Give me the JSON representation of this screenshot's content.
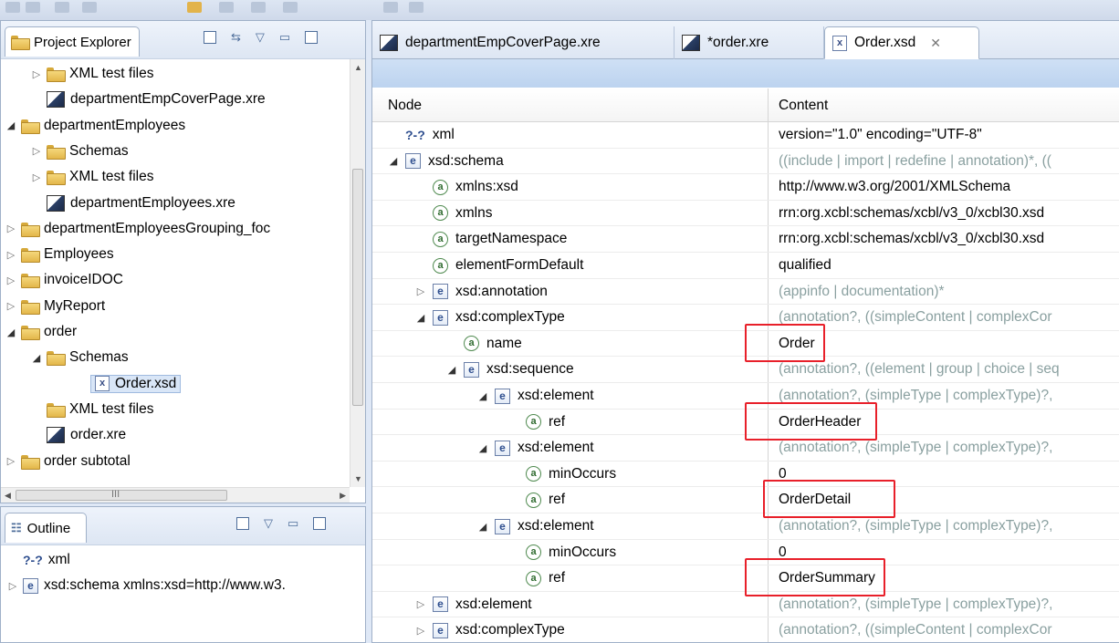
{
  "explorer": {
    "title": "Project Explorer",
    "items": [
      {
        "label": "XML test files",
        "type": "folder",
        "level": 2,
        "expand": "closed"
      },
      {
        "label": "departmentEmpCoverPage.xre",
        "type": "xre",
        "level": 2,
        "expand": "none"
      },
      {
        "label": "departmentEmployees",
        "type": "folder",
        "level": 1,
        "expand": "open"
      },
      {
        "label": "Schemas",
        "type": "folder",
        "level": 2,
        "expand": "closed"
      },
      {
        "label": "XML test files",
        "type": "folder",
        "level": 2,
        "expand": "closed"
      },
      {
        "label": "departmentEmployees.xre",
        "type": "xre",
        "level": 2,
        "expand": "none"
      },
      {
        "label": "departmentEmployeesGrouping_foc",
        "type": "folder",
        "level": 1,
        "expand": "closed"
      },
      {
        "label": "Employees",
        "type": "folder",
        "level": 1,
        "expand": "closed"
      },
      {
        "label": "invoiceIDOC",
        "type": "folder",
        "level": 1,
        "expand": "closed"
      },
      {
        "label": "MyReport",
        "type": "folder",
        "level": 1,
        "expand": "closed"
      },
      {
        "label": "order",
        "type": "folder",
        "level": 1,
        "expand": "open"
      },
      {
        "label": "Schemas",
        "type": "folder",
        "level": 2,
        "expand": "open"
      },
      {
        "label": "Order.xsd",
        "type": "xsd",
        "level": 3,
        "expand": "none",
        "selected": true
      },
      {
        "label": "XML test files",
        "type": "folder",
        "level": 2,
        "expand": "none"
      },
      {
        "label": "order.xre",
        "type": "xre",
        "level": 2,
        "expand": "none"
      },
      {
        "label": "order subtotal",
        "type": "folder",
        "level": 1,
        "expand": "closed"
      }
    ],
    "hscroll_mark": "III"
  },
  "outline": {
    "title": "Outline",
    "items": [
      {
        "icon": "?-?",
        "label": "xml",
        "expand": "none"
      },
      {
        "icon": "e",
        "label": "xsd:schema xmlns:xsd=http://www.w3.",
        "expand": "closed"
      }
    ]
  },
  "editor": {
    "tabs": [
      {
        "label": "departmentEmpCoverPage.xre",
        "type": "xre"
      },
      {
        "label": "*order.xre",
        "type": "xre"
      },
      {
        "label": "Order.xsd",
        "type": "xsd",
        "active": true
      }
    ],
    "columns": {
      "node": "Node",
      "content": "Content"
    },
    "rows": [
      {
        "icon": "?-?",
        "node": "xml",
        "content": "version=\"1.0\" encoding=\"UTF-8\"",
        "indent": 0,
        "expand": "none",
        "gray": false
      },
      {
        "icon": "e",
        "node": "xsd:schema",
        "content": "((include | import | redefine | annotation)*, ((",
        "indent": 0,
        "expand": "open",
        "gray": true
      },
      {
        "icon": "a",
        "node": "xmlns:xsd",
        "content": "http://www.w3.org/2001/XMLSchema",
        "indent": 1,
        "expand": "none",
        "gray": false
      },
      {
        "icon": "a",
        "node": "xmlns",
        "content": "rrn:org.xcbl:schemas/xcbl/v3_0/xcbl30.xsd",
        "indent": 1,
        "expand": "none",
        "gray": false
      },
      {
        "icon": "a",
        "node": "targetNamespace",
        "content": "rrn:org.xcbl:schemas/xcbl/v3_0/xcbl30.xsd",
        "indent": 1,
        "expand": "none",
        "gray": false
      },
      {
        "icon": "a",
        "node": "elementFormDefault",
        "content": "qualified",
        "indent": 1,
        "expand": "none",
        "gray": false
      },
      {
        "icon": "e",
        "node": "xsd:annotation",
        "content": "(appinfo | documentation)*",
        "indent": 1,
        "expand": "closed",
        "gray": true
      },
      {
        "icon": "e",
        "node": "xsd:complexType",
        "content": "(annotation?, ((simpleContent | complexCor",
        "indent": 1,
        "expand": "open",
        "gray": true
      },
      {
        "icon": "a",
        "node": "name",
        "content": "Order",
        "indent": 2,
        "expand": "none",
        "gray": false
      },
      {
        "icon": "e",
        "node": "xsd:sequence",
        "content": "(annotation?, ((element | group | choice | seq",
        "indent": 2,
        "expand": "open",
        "gray": true
      },
      {
        "icon": "e",
        "node": "xsd:element",
        "content": "(annotation?, (simpleType | complexType)?,",
        "indent": 3,
        "expand": "open",
        "gray": true
      },
      {
        "icon": "a",
        "node": "ref",
        "content": "OrderHeader",
        "indent": 4,
        "expand": "none",
        "gray": false
      },
      {
        "icon": "e",
        "node": "xsd:element",
        "content": "(annotation?, (simpleType | complexType)?,",
        "indent": 3,
        "expand": "open",
        "gray": true
      },
      {
        "icon": "a",
        "node": "minOccurs",
        "content": "0",
        "indent": 4,
        "expand": "none",
        "gray": false
      },
      {
        "icon": "a",
        "node": "ref",
        "content": "OrderDetail",
        "indent": 4,
        "expand": "none",
        "gray": false
      },
      {
        "icon": "e",
        "node": "xsd:element",
        "content": "(annotation?, (simpleType | complexType)?,",
        "indent": 3,
        "expand": "open",
        "gray": true
      },
      {
        "icon": "a",
        "node": "minOccurs",
        "content": "0",
        "indent": 4,
        "expand": "none",
        "gray": false
      },
      {
        "icon": "a",
        "node": "ref",
        "content": "OrderSummary",
        "indent": 4,
        "expand": "none",
        "gray": false
      },
      {
        "icon": "e",
        "node": "xsd:element",
        "content": "(annotation?, (simpleType | complexType)?,",
        "indent": 1,
        "expand": "closed",
        "gray": true
      },
      {
        "icon": "e",
        "node": "xsd:complexType",
        "content": "(annotation?, ((simpleContent | complexCor",
        "indent": 1,
        "expand": "closed",
        "gray": true
      }
    ],
    "highlighted_values": [
      "Order",
      "OrderHeader",
      "OrderDetail",
      "OrderSummary"
    ]
  },
  "colors": {
    "highlight": "#e8202a",
    "gray_content": "#8aa0a0",
    "tab_bg": "#dde6f3"
  }
}
